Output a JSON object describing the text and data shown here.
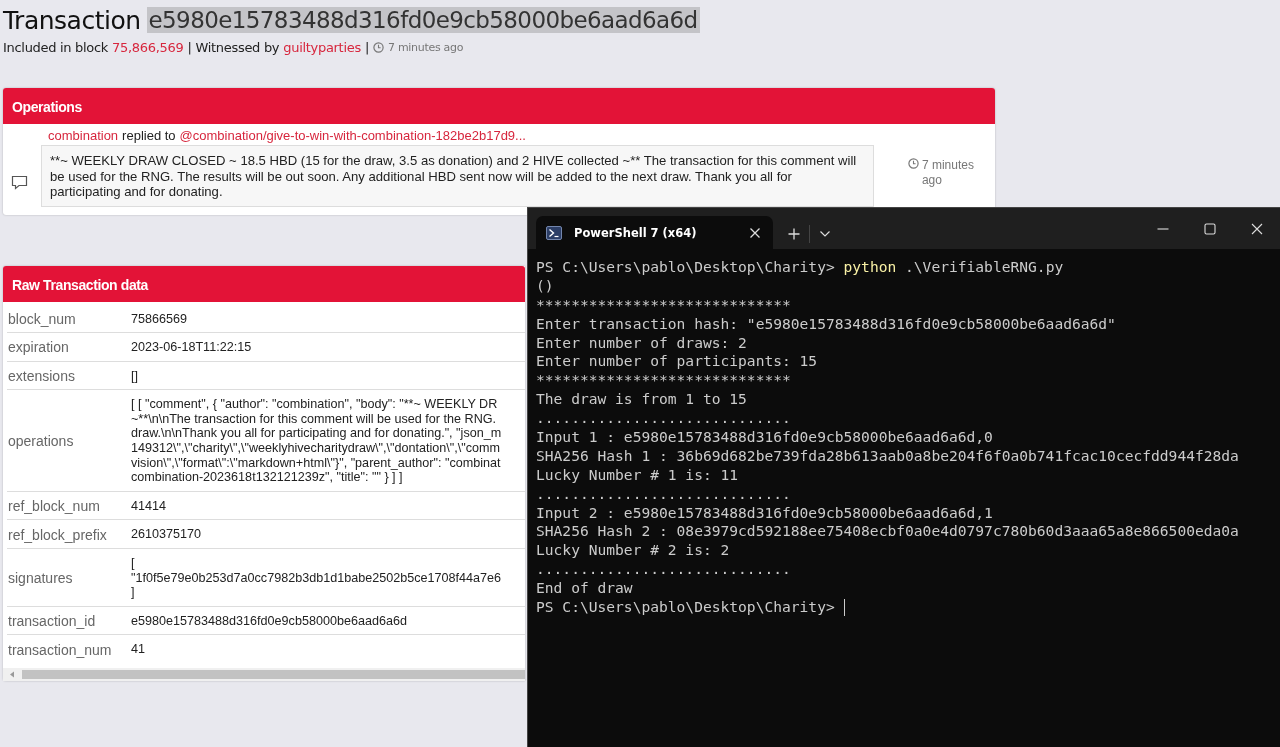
{
  "page": {
    "title": "Transaction",
    "hash": "e5980e15783488d316fd0e9cb58000be6aad6a6d",
    "meta": [
      {
        "kind": "text",
        "text": "Included in block"
      },
      {
        "kind": "link",
        "text": "75,866,569"
      },
      {
        "kind": "text",
        "text": "| Witnessed by"
      },
      {
        "kind": "link",
        "text": "guiltyparties"
      },
      {
        "kind": "text",
        "text": "|"
      },
      {
        "kind": "time",
        "text": "7 minutes ago"
      }
    ]
  },
  "operations": {
    "title": "Operations",
    "author": "combination",
    "action": "replied to",
    "target": "@combination/give-to-win-with-combination-182be2b17d9...",
    "body": "**~ WEEKLY DRAW CLOSED ~ 18.5 HBD (15 for the draw, 3.5 as donation) and 2 HIVE collected ~** The transaction for this comment will be used for the RNG. The results will be out soon. Any additional HBD sent now will be added to the next draw. Thank you all for participating and for donating.",
    "time": "7 minutes ago"
  },
  "raw": {
    "title": "Raw Transaction data",
    "rows": [
      {
        "key": "block_num",
        "lines": [
          "75866569"
        ]
      },
      {
        "key": "expiration",
        "lines": [
          "2023-06-18T11:22:15"
        ]
      },
      {
        "key": "extensions",
        "lines": [
          "[]"
        ]
      },
      {
        "key": "operations",
        "lines": [
          "[ [ \"comment\", { \"author\": \"combination\", \"body\": \"**~ WEEKLY DR",
          "~**\\n\\nThe transaction for this comment will be used for the RNG.",
          "draw.\\n\\nThank you all for participating and for donating.\", \"json_m",
          "149312\\\",\\\"charity\\\",\\\"weeklyhivecharitydraw\\\",\\\"dontation\\\",\\\"comm",
          "vision\\\",\\\"format\\\":\\\"markdown+html\\\"}\", \"parent_author\": \"combinat",
          "combination-2023618t132121239z\", \"title\": \"\" } ] ]"
        ]
      },
      {
        "key": "ref_block_num",
        "lines": [
          "41414"
        ]
      },
      {
        "key": "ref_block_prefix",
        "lines": [
          "2610375170"
        ]
      },
      {
        "key": "signatures",
        "lines": [
          "[",
          "\"1f0f5e79e0b253d7a0cc7982b3db1d1babe2502b5ce1708f44a7e6",
          "]"
        ]
      },
      {
        "key": "transaction_id",
        "lines": [
          "e5980e15783488d316fd0e9cb58000be6aad6a6d"
        ]
      },
      {
        "key": "transaction_num",
        "lines": [
          "41"
        ]
      }
    ]
  },
  "terminal": {
    "tab": "PowerShell 7 (x64)",
    "lines": [
      {
        "kind": "prompt",
        "prompt": "PS C:\\Users\\pablo\\Desktop\\Charity>",
        "command": "python",
        "args": ".\\VerifiableRNG.py",
        "cursor": false
      },
      {
        "kind": "output",
        "text": "()"
      },
      {
        "kind": "output",
        "text": "*****************************"
      },
      {
        "kind": "output",
        "text": "Enter transaction hash: \"e5980e15783488d316fd0e9cb58000be6aad6a6d\""
      },
      {
        "kind": "output",
        "text": "Enter number of draws: 2"
      },
      {
        "kind": "output",
        "text": "Enter number of participants: 15"
      },
      {
        "kind": "output",
        "text": "*****************************"
      },
      {
        "kind": "output",
        "text": "The draw is from 1 to 15"
      },
      {
        "kind": "output",
        "text": "............................."
      },
      {
        "kind": "output",
        "text": "Input 1 : e5980e15783488d316fd0e9cb58000be6aad6a6d,0"
      },
      {
        "kind": "output",
        "text": "SHA256 Hash 1 : 36b69d682be739fda28b613aab0a8be204f6f0a0b741fcac10cecfdd944f28da"
      },
      {
        "kind": "output",
        "text": "Lucky Number # 1 is: 11"
      },
      {
        "kind": "output",
        "text": "............................."
      },
      {
        "kind": "output",
        "text": "Input 2 : e5980e15783488d316fd0e9cb58000be6aad6a6d,1"
      },
      {
        "kind": "output",
        "text": "SHA256 Hash 2 : 08e3979cd592188ee75408ecbf0a0e4d0797c780b60d3aaa65a8e866500eda0a"
      },
      {
        "kind": "output",
        "text": "Lucky Number # 2 is: 2"
      },
      {
        "kind": "output",
        "text": "............................."
      },
      {
        "kind": "output",
        "text": "End of draw"
      },
      {
        "kind": "prompt",
        "prompt": "PS C:\\Users\\pablo\\Desktop\\Charity>",
        "cursor": true
      }
    ]
  }
}
